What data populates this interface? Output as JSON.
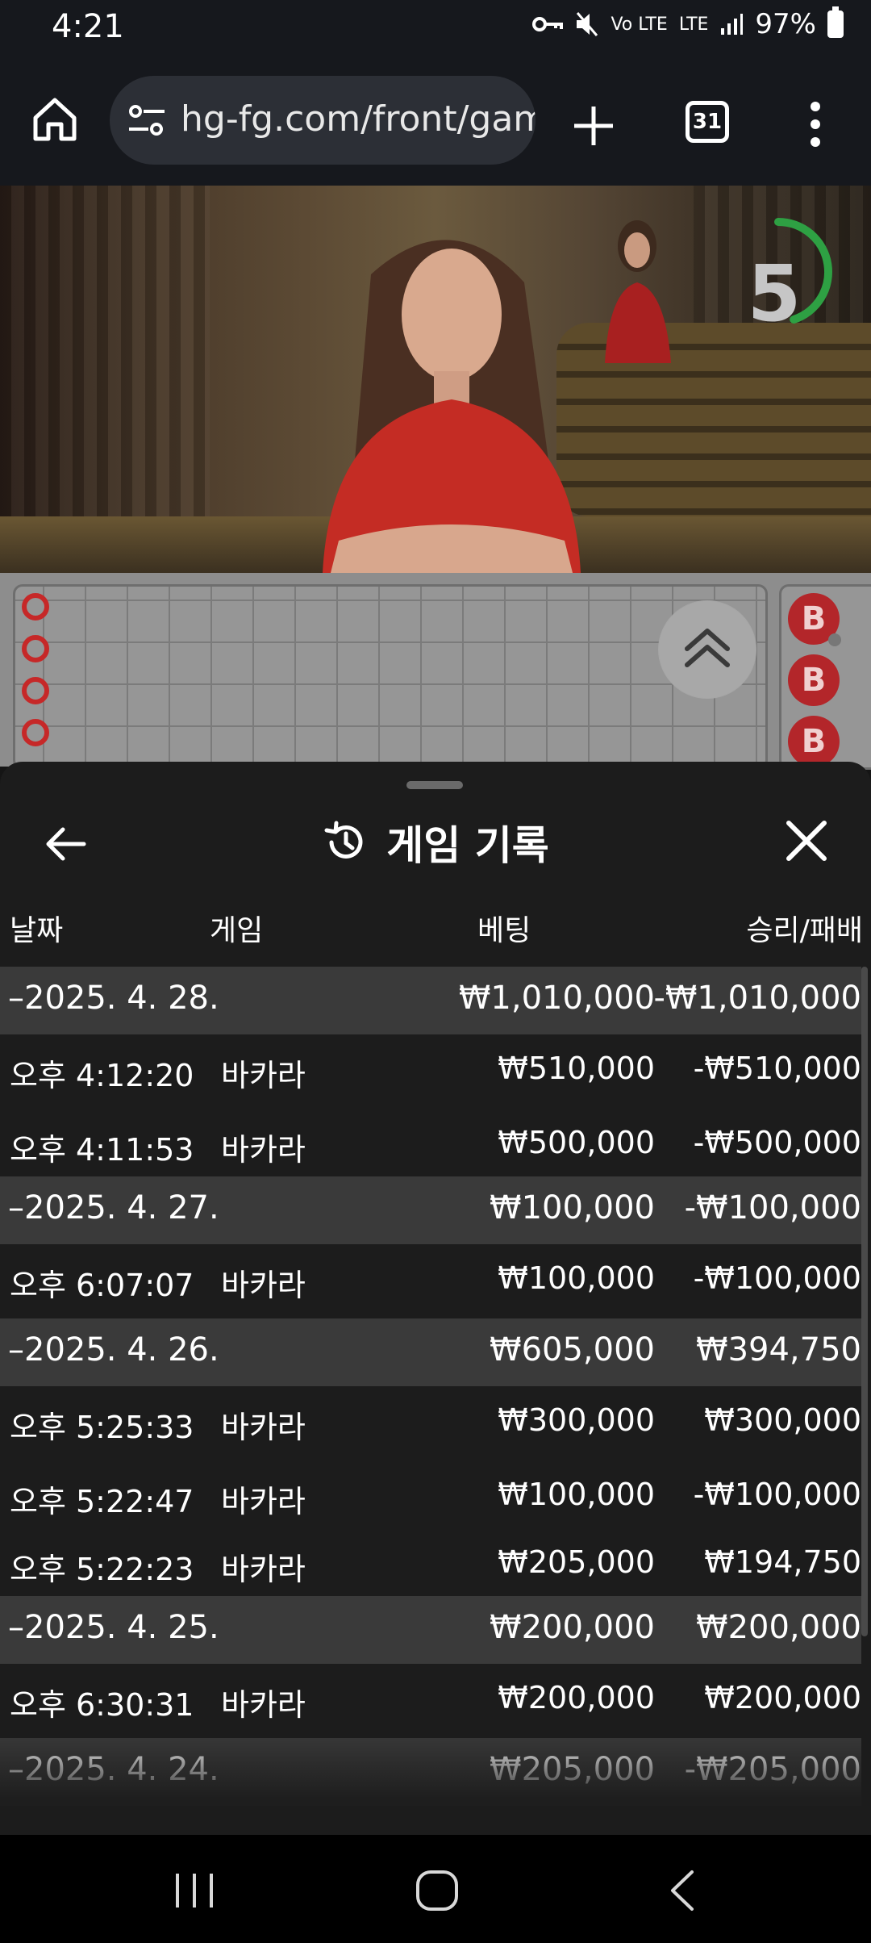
{
  "status_bar": {
    "time": "4:21",
    "network_label": "LTE",
    "volte_label": "Vo LTE",
    "battery_text": "97%"
  },
  "browser": {
    "url": "hg-fg.com/front/gam",
    "tab_count": "31"
  },
  "video": {
    "countdown": "5",
    "countdown_fraction": 0.45
  },
  "scoreboard": {
    "bead_labels": [
      "B",
      "B",
      "B"
    ]
  },
  "history_sheet": {
    "title": "게임 기록",
    "columns": {
      "date": "날짜",
      "game": "게임",
      "bet": "베팅",
      "result": "승리/패배"
    },
    "groups": [
      {
        "date": "–2025. 4. 28.",
        "bet": "₩1,010,000",
        "result": "-₩1,010,000",
        "entries": [
          {
            "time": "오후 4:12:20",
            "game": "바카라",
            "bet": "₩510,000",
            "result": "-₩510,000"
          },
          {
            "time": "오후 4:11:53",
            "game": "바카라",
            "bet": "₩500,000",
            "result": "-₩500,000"
          }
        ]
      },
      {
        "date": "–2025. 4. 27.",
        "bet": "₩100,000",
        "result": "-₩100,000",
        "entries": [
          {
            "time": "오후 6:07:07",
            "game": "바카라",
            "bet": "₩100,000",
            "result": "-₩100,000"
          }
        ]
      },
      {
        "date": "–2025. 4. 26.",
        "bet": "₩605,000",
        "result": "₩394,750",
        "entries": [
          {
            "time": "오후 5:25:33",
            "game": "바카라",
            "bet": "₩300,000",
            "result": "₩300,000"
          },
          {
            "time": "오후 5:22:47",
            "game": "바카라",
            "bet": "₩100,000",
            "result": "-₩100,000"
          },
          {
            "time": "오후 5:22:23",
            "game": "바카라",
            "bet": "₩205,000",
            "result": "₩194,750"
          }
        ]
      },
      {
        "date": "–2025. 4. 25.",
        "bet": "₩200,000",
        "result": "₩200,000",
        "entries": [
          {
            "time": "오후 6:30:31",
            "game": "바카라",
            "bet": "₩200,000",
            "result": "₩200,000"
          }
        ]
      },
      {
        "date": "–2025. 4. 24.",
        "bet": "₩205,000",
        "result": "-₩205,000",
        "entries": []
      }
    ]
  }
}
